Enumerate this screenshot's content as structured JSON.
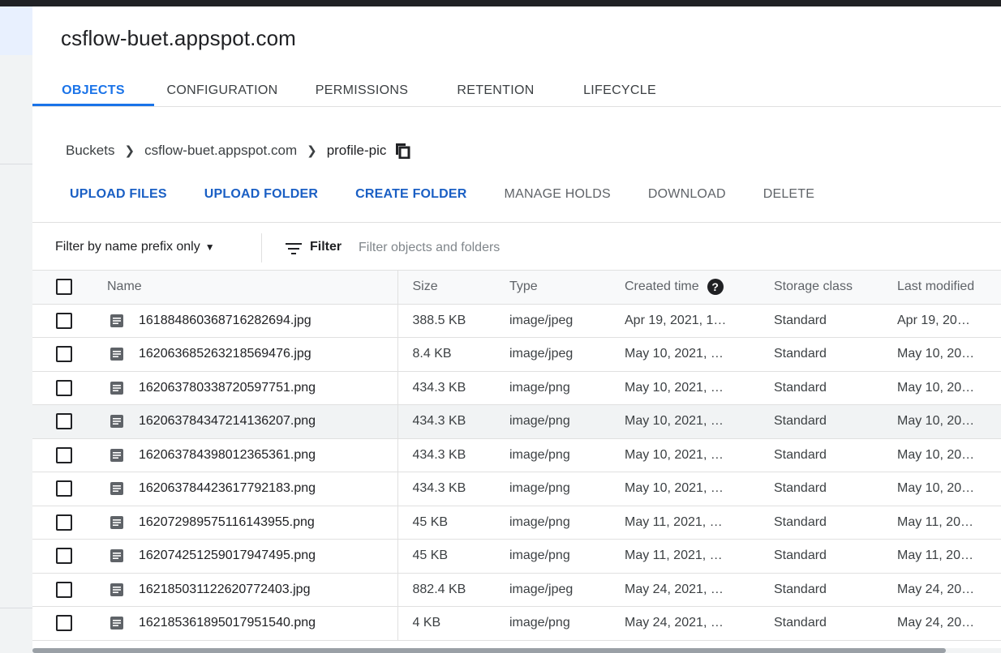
{
  "bucket": {
    "title": "csflow-buet.appspot.com"
  },
  "tabs": [
    {
      "label": "OBJECTS",
      "active": true
    },
    {
      "label": "CONFIGURATION"
    },
    {
      "label": "PERMISSIONS"
    },
    {
      "label": "RETENTION"
    },
    {
      "label": "LIFECYCLE"
    }
  ],
  "breadcrumb": {
    "root": "Buckets",
    "bucket": "csflow-buet.appspot.com",
    "folder": "profile-pic",
    "copy_icon": "copy-icon"
  },
  "actions": {
    "upload_files": "UPLOAD FILES",
    "upload_folder": "UPLOAD FOLDER",
    "create_folder": "CREATE FOLDER",
    "manage_holds": "MANAGE HOLDS",
    "download": "DOWNLOAD",
    "delete": "DELETE"
  },
  "filter": {
    "mode": "Filter by name prefix only",
    "label": "Filter",
    "placeholder": "Filter objects and folders"
  },
  "table": {
    "headers": {
      "name": "Name",
      "size": "Size",
      "type": "Type",
      "created": "Created time",
      "storage": "Storage class",
      "last_modified": "Last modified"
    },
    "rows": [
      {
        "name": "1618848603687162826​94.jpg",
        "size": "388.5 KB",
        "type": "image/jpeg",
        "created": "Apr 19, 2021, 1…",
        "storage": "Standard",
        "last": "Apr 19, 20…"
      },
      {
        "name": "16206368526321856947​6.jpg",
        "size": "8.4 KB",
        "type": "image/jpeg",
        "created": "May 10, 2021, …",
        "storage": "Standard",
        "last": "May 10, 20…"
      },
      {
        "name": "16206378033872059775​1.png",
        "size": "434.3 KB",
        "type": "image/png",
        "created": "May 10, 2021, …",
        "storage": "Standard",
        "last": "May 10, 20…"
      },
      {
        "name": "16206378434721413620​7.png",
        "size": "434.3 KB",
        "type": "image/png",
        "created": "May 10, 2021, …",
        "storage": "Standard",
        "last": "May 10, 20…"
      },
      {
        "name": "16206378439801236536​1.png",
        "size": "434.3 KB",
        "type": "image/png",
        "created": "May 10, 2021, …",
        "storage": "Standard",
        "last": "May 10, 20…"
      },
      {
        "name": "16206378442361779218​3.png",
        "size": "434.3 KB",
        "type": "image/png",
        "created": "May 10, 2021, …",
        "storage": "Standard",
        "last": "May 10, 20…"
      },
      {
        "name": "16207298957511614395​5.png",
        "size": "45 KB",
        "type": "image/png",
        "created": "May 11, 2021, …",
        "storage": "Standard",
        "last": "May 11, 20…"
      },
      {
        "name": "16207425125901794749​5.png",
        "size": "45 KB",
        "type": "image/png",
        "created": "May 11, 2021, …",
        "storage": "Standard",
        "last": "May 11, 20…"
      },
      {
        "name": "16218503112262077240​3.jpg",
        "size": "882.4 KB",
        "type": "image/jpeg",
        "created": "May 24, 2021, …",
        "storage": "Standard",
        "last": "May 24, 20…"
      },
      {
        "name": "16218536189501795154​0.png",
        "size": "4 KB",
        "type": "image/png",
        "created": "May 24, 2021, …",
        "storage": "Standard",
        "last": "May 24, 20…"
      }
    ]
  },
  "icons": {
    "file": "document-icon",
    "help": "help-circle-icon",
    "filter": "filter-lines-icon"
  }
}
